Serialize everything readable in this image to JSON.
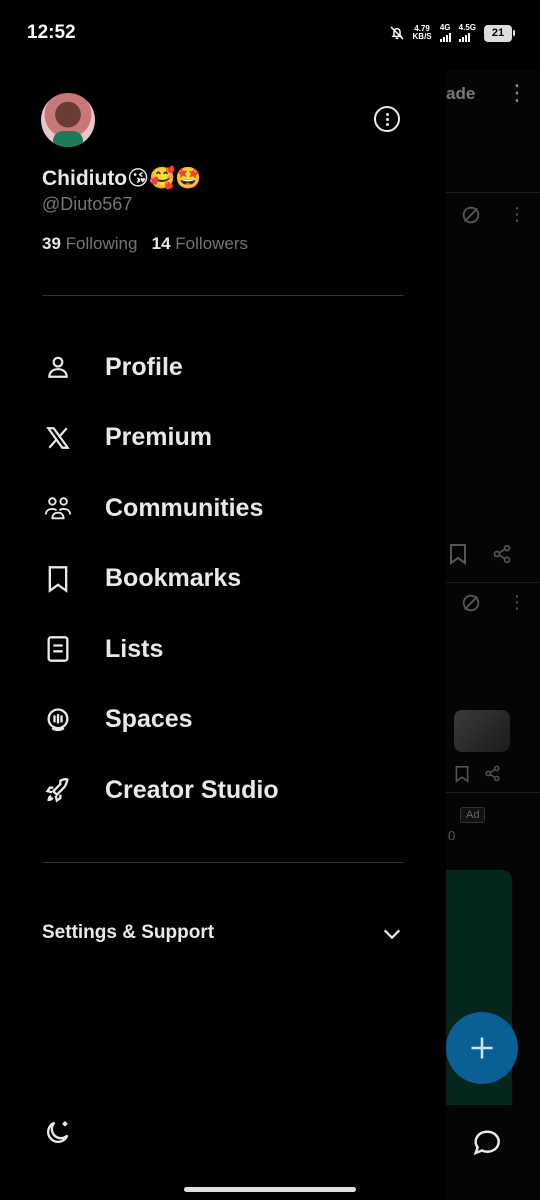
{
  "status": {
    "time": "12:52",
    "net_speed_value": "4.79",
    "net_speed_unit": "KB/S",
    "sim1": "4G",
    "sim2": "4.5G",
    "battery": "21"
  },
  "background": {
    "title_fragment": "ade",
    "ad_label": "Ad",
    "count_fragment": "0"
  },
  "profile": {
    "name": "Chidiuto😘🥰🤩",
    "handle": "@Diuto567",
    "following_count": "39",
    "following_label": "Following",
    "followers_count": "14",
    "followers_label": "Followers"
  },
  "menu": {
    "items": [
      {
        "label": "Profile",
        "icon": "person-icon"
      },
      {
        "label": "Premium",
        "icon": "x-logo-icon"
      },
      {
        "label": "Communities",
        "icon": "communities-icon"
      },
      {
        "label": "Bookmarks",
        "icon": "bookmark-icon"
      },
      {
        "label": "Lists",
        "icon": "list-icon"
      },
      {
        "label": "Spaces",
        "icon": "spaces-icon"
      },
      {
        "label": "Creator Studio",
        "icon": "rocket-icon"
      }
    ]
  },
  "settings": {
    "label": "Settings & Support"
  },
  "colors": {
    "background": "#000000",
    "text": "#e7e9ea",
    "muted": "#71767b",
    "fab": "#0a5f94"
  }
}
